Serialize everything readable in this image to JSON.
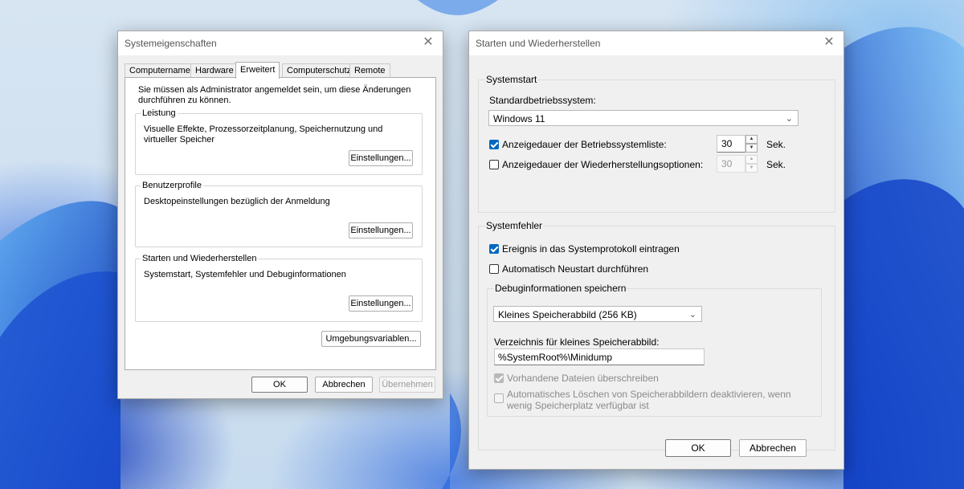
{
  "system_properties": {
    "title": "Systemeigenschaften",
    "tabs": [
      "Computername",
      "Hardware",
      "Erweitert",
      "Computerschutz",
      "Remote"
    ],
    "active_tab": "Erweitert",
    "admin_note": "Sie müssen als Administrator angemeldet sein, um diese Änderungen durchführen zu können.",
    "groups": [
      {
        "title": "Leistung",
        "description": "Visuelle Effekte, Prozessorzeitplanung, Speichernutzung und virtueller Speicher",
        "button": "Einstellungen..."
      },
      {
        "title": "Benutzerprofile",
        "description": "Desktopeinstellungen bezüglich der Anmeldung",
        "button": "Einstellungen..."
      },
      {
        "title": "Starten und Wiederherstellen",
        "description": "Systemstart, Systemfehler und Debuginformationen",
        "button": "Einstellungen..."
      }
    ],
    "env_button": "Umgebungsvariablen...",
    "buttons": {
      "ok": "OK",
      "cancel": "Abbrechen",
      "apply": "Übernehmen"
    }
  },
  "startup_recovery": {
    "title": "Starten und Wiederherstellen",
    "systemstart": {
      "legend": "Systemstart",
      "default_os_label": "Standardbetriebssystem:",
      "default_os_value": "Windows 11",
      "show_list_label": "Anzeigedauer der Betriebssystemliste:",
      "show_list_checked": true,
      "show_list_value": "30",
      "show_recovery_label": "Anzeigedauer der Wiederherstellungsoptionen:",
      "show_recovery_checked": false,
      "show_recovery_value": "30",
      "unit": "Sek."
    },
    "systemfehler": {
      "legend": "Systemfehler",
      "log_event_label": "Ereignis in das Systemprotokoll eintragen",
      "log_event_checked": true,
      "auto_restart_label": "Automatisch Neustart durchführen",
      "auto_restart_checked": false,
      "debug_legend": "Debuginformationen speichern",
      "dump_type_value": "Kleines Speicherabbild (256 KB)",
      "dump_dir_label": "Verzeichnis für kleines Speicherabbild:",
      "dump_dir_value": "%SystemRoot%\\Minidump",
      "overwrite_label": "Vorhandene Dateien überschreiben",
      "overwrite_checked": true,
      "disable_auto_delete_label_1": "Automatisches Löschen von Speicherabbildern deaktivieren, wenn",
      "disable_auto_delete_label_2": "wenig Speicherplatz verfügbar ist",
      "disable_auto_delete_checked": false
    },
    "buttons": {
      "ok": "OK",
      "cancel": "Abbrechen"
    }
  },
  "colors": {
    "accent": "#0067c0",
    "dialog_bg": "#f0f0f0",
    "wallpaper_blue": "#1e5ad8"
  },
  "icons": {
    "close": "close-icon",
    "dropdown": "chevron-down-icon",
    "spin_up": "spin-up-icon",
    "spin_down": "spin-down-icon"
  }
}
